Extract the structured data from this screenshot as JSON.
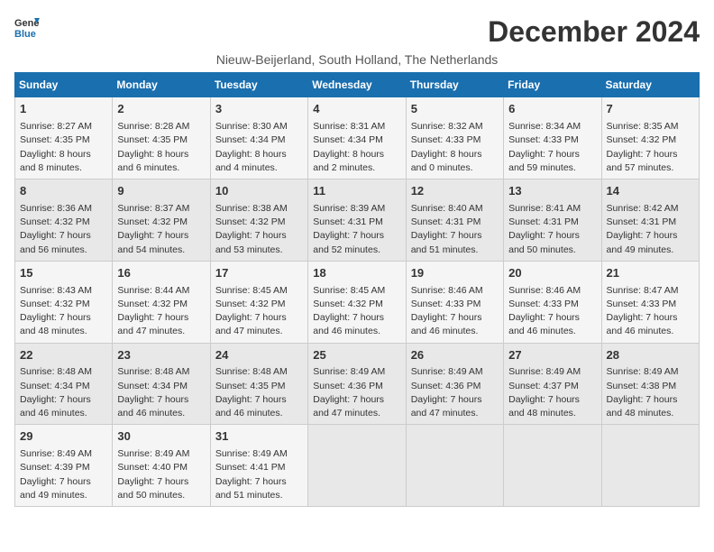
{
  "logo": {
    "general": "General",
    "blue": "Blue"
  },
  "title": "December 2024",
  "subtitle": "Nieuw-Beijerland, South Holland, The Netherlands",
  "days_header": [
    "Sunday",
    "Monday",
    "Tuesday",
    "Wednesday",
    "Thursday",
    "Friday",
    "Saturday"
  ],
  "weeks": [
    [
      {
        "day": 1,
        "lines": [
          "Sunrise: 8:27 AM",
          "Sunset: 4:35 PM",
          "Daylight: 8 hours",
          "and 8 minutes."
        ]
      },
      {
        "day": 2,
        "lines": [
          "Sunrise: 8:28 AM",
          "Sunset: 4:35 PM",
          "Daylight: 8 hours",
          "and 6 minutes."
        ]
      },
      {
        "day": 3,
        "lines": [
          "Sunrise: 8:30 AM",
          "Sunset: 4:34 PM",
          "Daylight: 8 hours",
          "and 4 minutes."
        ]
      },
      {
        "day": 4,
        "lines": [
          "Sunrise: 8:31 AM",
          "Sunset: 4:34 PM",
          "Daylight: 8 hours",
          "and 2 minutes."
        ]
      },
      {
        "day": 5,
        "lines": [
          "Sunrise: 8:32 AM",
          "Sunset: 4:33 PM",
          "Daylight: 8 hours",
          "and 0 minutes."
        ]
      },
      {
        "day": 6,
        "lines": [
          "Sunrise: 8:34 AM",
          "Sunset: 4:33 PM",
          "Daylight: 7 hours",
          "and 59 minutes."
        ]
      },
      {
        "day": 7,
        "lines": [
          "Sunrise: 8:35 AM",
          "Sunset: 4:32 PM",
          "Daylight: 7 hours",
          "and 57 minutes."
        ]
      }
    ],
    [
      {
        "day": 8,
        "lines": [
          "Sunrise: 8:36 AM",
          "Sunset: 4:32 PM",
          "Daylight: 7 hours",
          "and 56 minutes."
        ]
      },
      {
        "day": 9,
        "lines": [
          "Sunrise: 8:37 AM",
          "Sunset: 4:32 PM",
          "Daylight: 7 hours",
          "and 54 minutes."
        ]
      },
      {
        "day": 10,
        "lines": [
          "Sunrise: 8:38 AM",
          "Sunset: 4:32 PM",
          "Daylight: 7 hours",
          "and 53 minutes."
        ]
      },
      {
        "day": 11,
        "lines": [
          "Sunrise: 8:39 AM",
          "Sunset: 4:31 PM",
          "Daylight: 7 hours",
          "and 52 minutes."
        ]
      },
      {
        "day": 12,
        "lines": [
          "Sunrise: 8:40 AM",
          "Sunset: 4:31 PM",
          "Daylight: 7 hours",
          "and 51 minutes."
        ]
      },
      {
        "day": 13,
        "lines": [
          "Sunrise: 8:41 AM",
          "Sunset: 4:31 PM",
          "Daylight: 7 hours",
          "and 50 minutes."
        ]
      },
      {
        "day": 14,
        "lines": [
          "Sunrise: 8:42 AM",
          "Sunset: 4:31 PM",
          "Daylight: 7 hours",
          "and 49 minutes."
        ]
      }
    ],
    [
      {
        "day": 15,
        "lines": [
          "Sunrise: 8:43 AM",
          "Sunset: 4:32 PM",
          "Daylight: 7 hours",
          "and 48 minutes."
        ]
      },
      {
        "day": 16,
        "lines": [
          "Sunrise: 8:44 AM",
          "Sunset: 4:32 PM",
          "Daylight: 7 hours",
          "and 47 minutes."
        ]
      },
      {
        "day": 17,
        "lines": [
          "Sunrise: 8:45 AM",
          "Sunset: 4:32 PM",
          "Daylight: 7 hours",
          "and 47 minutes."
        ]
      },
      {
        "day": 18,
        "lines": [
          "Sunrise: 8:45 AM",
          "Sunset: 4:32 PM",
          "Daylight: 7 hours",
          "and 46 minutes."
        ]
      },
      {
        "day": 19,
        "lines": [
          "Sunrise: 8:46 AM",
          "Sunset: 4:33 PM",
          "Daylight: 7 hours",
          "and 46 minutes."
        ]
      },
      {
        "day": 20,
        "lines": [
          "Sunrise: 8:46 AM",
          "Sunset: 4:33 PM",
          "Daylight: 7 hours",
          "and 46 minutes."
        ]
      },
      {
        "day": 21,
        "lines": [
          "Sunrise: 8:47 AM",
          "Sunset: 4:33 PM",
          "Daylight: 7 hours",
          "and 46 minutes."
        ]
      }
    ],
    [
      {
        "day": 22,
        "lines": [
          "Sunrise: 8:48 AM",
          "Sunset: 4:34 PM",
          "Daylight: 7 hours",
          "and 46 minutes."
        ]
      },
      {
        "day": 23,
        "lines": [
          "Sunrise: 8:48 AM",
          "Sunset: 4:34 PM",
          "Daylight: 7 hours",
          "and 46 minutes."
        ]
      },
      {
        "day": 24,
        "lines": [
          "Sunrise: 8:48 AM",
          "Sunset: 4:35 PM",
          "Daylight: 7 hours",
          "and 46 minutes."
        ]
      },
      {
        "day": 25,
        "lines": [
          "Sunrise: 8:49 AM",
          "Sunset: 4:36 PM",
          "Daylight: 7 hours",
          "and 47 minutes."
        ]
      },
      {
        "day": 26,
        "lines": [
          "Sunrise: 8:49 AM",
          "Sunset: 4:36 PM",
          "Daylight: 7 hours",
          "and 47 minutes."
        ]
      },
      {
        "day": 27,
        "lines": [
          "Sunrise: 8:49 AM",
          "Sunset: 4:37 PM",
          "Daylight: 7 hours",
          "and 48 minutes."
        ]
      },
      {
        "day": 28,
        "lines": [
          "Sunrise: 8:49 AM",
          "Sunset: 4:38 PM",
          "Daylight: 7 hours",
          "and 48 minutes."
        ]
      }
    ],
    [
      {
        "day": 29,
        "lines": [
          "Sunrise: 8:49 AM",
          "Sunset: 4:39 PM",
          "Daylight: 7 hours",
          "and 49 minutes."
        ]
      },
      {
        "day": 30,
        "lines": [
          "Sunrise: 8:49 AM",
          "Sunset: 4:40 PM",
          "Daylight: 7 hours",
          "and 50 minutes."
        ]
      },
      {
        "day": 31,
        "lines": [
          "Sunrise: 8:49 AM",
          "Sunset: 4:41 PM",
          "Daylight: 7 hours",
          "and 51 minutes."
        ]
      },
      null,
      null,
      null,
      null
    ]
  ]
}
